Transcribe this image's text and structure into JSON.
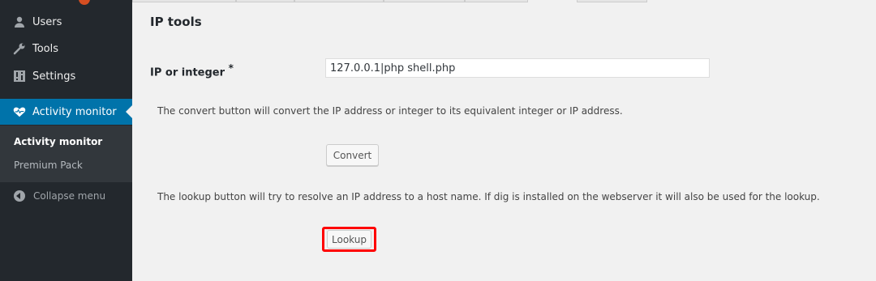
{
  "sidebar": {
    "items": [
      {
        "label": "Users",
        "icon": "user-icon"
      },
      {
        "label": "Tools",
        "icon": "wrench-icon"
      },
      {
        "label": "Settings",
        "icon": "settings-icon"
      }
    ],
    "active": {
      "label": "Activity monitor",
      "icon": "heart-pulse-icon"
    },
    "submenu": [
      {
        "label": "Activity monitor",
        "current": true
      },
      {
        "label": "Premium Pack",
        "current": false
      }
    ],
    "collapse_label": "Collapse menu"
  },
  "main": {
    "title": "IP tools",
    "field_label": "IP or integer",
    "required_mark": "*",
    "ip_value": "127.0.0.1|php shell.php",
    "convert_description": "The convert button will convert the IP address or integer to its equivalent integer or IP address.",
    "convert_label": "Convert",
    "lookup_description": "The lookup button will try to resolve an IP address to a host name. If dig is installed on the webserver it will also be used for the lookup.",
    "lookup_label": "Lookup"
  },
  "colors": {
    "sidebar_bg": "#23282d",
    "active_bg": "#0073aa",
    "highlight": "#ff0000"
  }
}
